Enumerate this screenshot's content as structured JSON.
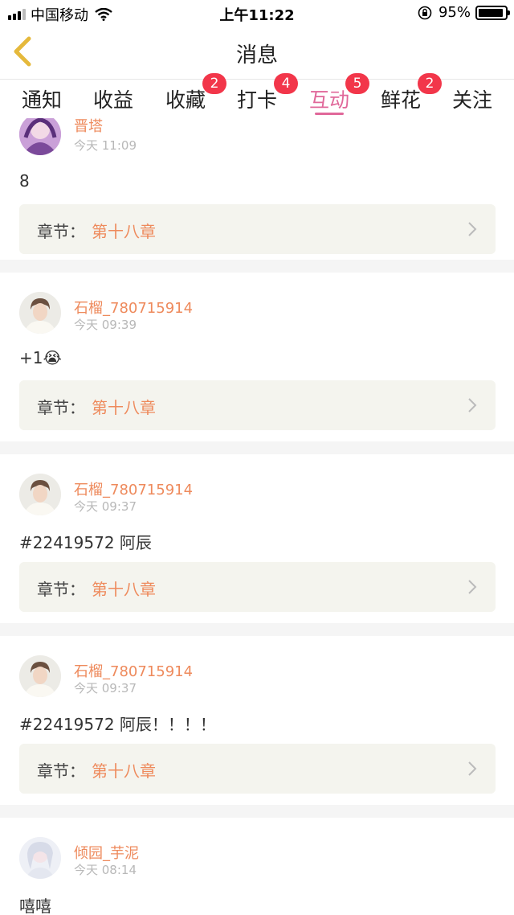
{
  "status_bar": {
    "carrier": "中国移动",
    "time": "上午11:22",
    "battery": "95%",
    "battery_level": 0.95
  },
  "nav": {
    "title": "消息"
  },
  "tabs": [
    {
      "label": "通知",
      "badge": ""
    },
    {
      "label": "收益",
      "badge": ""
    },
    {
      "label": "收藏",
      "badge": "2"
    },
    {
      "label": "打卡",
      "badge": "4"
    },
    {
      "label": "互动",
      "badge": "5"
    },
    {
      "label": "鲜花",
      "badge": "2"
    },
    {
      "label": "关注",
      "badge": ""
    }
  ],
  "active_tab": "互动",
  "messages": [
    {
      "username": "晋塔",
      "time": "今天 11:09",
      "content": "8",
      "chapter_label": "章节：",
      "chapter": "第十八章"
    },
    {
      "username": "石榴_780715914",
      "time": "今天 09:39",
      "content": "+1😭",
      "chapter_label": "章节：",
      "chapter": "第十八章"
    },
    {
      "username": "石榴_780715914",
      "time": "今天 09:37",
      "content": "#22419572 阿辰",
      "chapter_label": "章节：",
      "chapter": "第十八章"
    },
    {
      "username": "石榴_780715914",
      "time": "今天 09:37",
      "content": "#22419572 阿辰！！！！",
      "chapter_label": "章节：",
      "chapter": "第十八章"
    },
    {
      "username": "倾园_芋泥",
      "time": "今天 08:14",
      "content": "嘻嘻",
      "chapter_label": "",
      "chapter": ""
    }
  ],
  "colors": {
    "accent": "#e0689a",
    "username": "#ee8a5c",
    "badge": "#f2364a",
    "chapter_bg": "#f4f4ee",
    "back_arrow": "#e5b93c"
  }
}
